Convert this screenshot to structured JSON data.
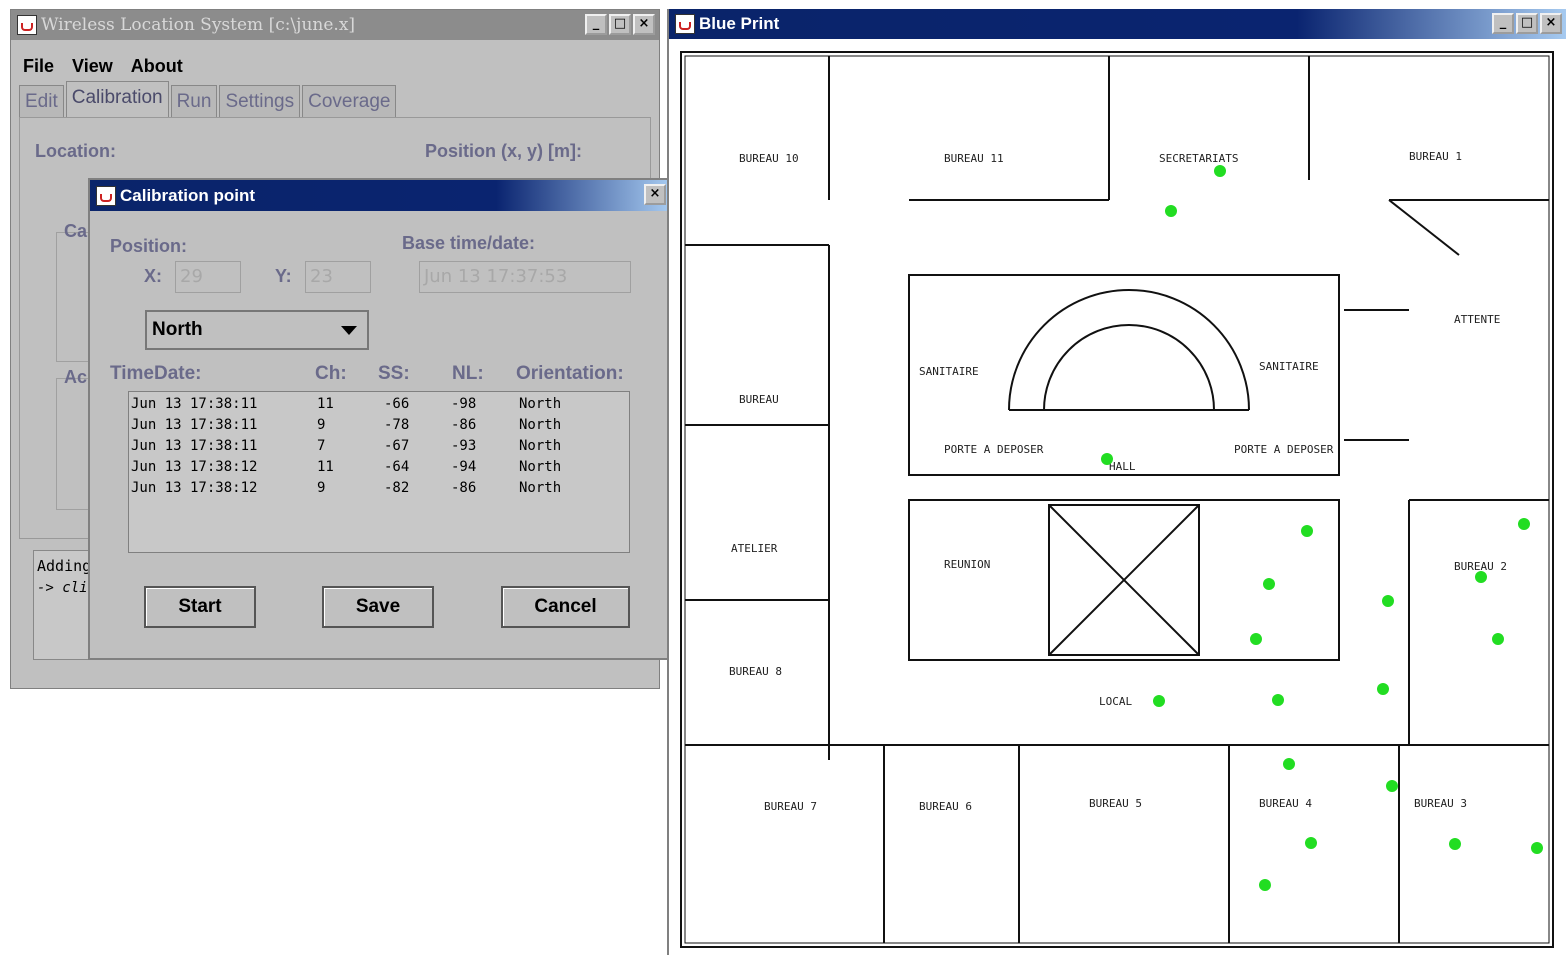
{
  "main_window": {
    "title": "Wireless Location System   [c:\\june.x]",
    "menu": [
      "File",
      "View",
      "About"
    ],
    "tabs": [
      "Edit",
      "Calibration",
      "Run",
      "Settings",
      "Coverage"
    ],
    "location_label": "Location:",
    "position_label": "Position (x, y) [m]:",
    "group_ca_fragment": "Ca",
    "group_ac_fragment": "Ac",
    "log_line1": "Adding",
    "log_line2": "-> clic"
  },
  "dialog": {
    "title": "Calibration point",
    "position_label": "Position:",
    "x_label": "X:",
    "x_value": "29",
    "y_label": "Y:",
    "y_value": "23",
    "base_time_label": "Base time/date:",
    "base_time_value": "Jun 13 17:37:53",
    "orientation_selected": "North",
    "columns": [
      "TimeDate:",
      "Ch:",
      "SS:",
      "NL:",
      "Orientation:"
    ],
    "rows": [
      [
        "Jun 13 17:38:11",
        "11",
        "-66",
        "-98",
        "North"
      ],
      [
        "Jun 13 17:38:11",
        "9",
        "-78",
        "-86",
        "North"
      ],
      [
        "Jun 13 17:38:11",
        "7",
        "-67",
        "-93",
        "North"
      ],
      [
        "Jun 13 17:38:12",
        "11",
        "-64",
        "-94",
        "North"
      ],
      [
        "Jun 13 17:38:12",
        "9",
        "-82",
        "-86",
        "North"
      ]
    ],
    "buttons": {
      "start": "Start",
      "save": "Save",
      "cancel": "Cancel"
    }
  },
  "blueprint": {
    "title": "Blue Print",
    "point_color": "#22dd22",
    "rooms": [
      "BUREAU 10",
      "BUREAU 11",
      "SECRETARIATS",
      "BUREAU 1",
      "ATTENTE",
      "SANITAIRE",
      "SANITAIRE",
      "BUREAU",
      "PORTE A DEPOSER",
      "PORTE A DEPOSER",
      "HALL",
      "ATELIER",
      "REUNION",
      "BUREAU 2",
      "BUREAU 8",
      "LOCAL",
      "BUREAU 7",
      "BUREAU 6",
      "BUREAU 5",
      "BUREAU 4",
      "BUREAU 3"
    ]
  }
}
